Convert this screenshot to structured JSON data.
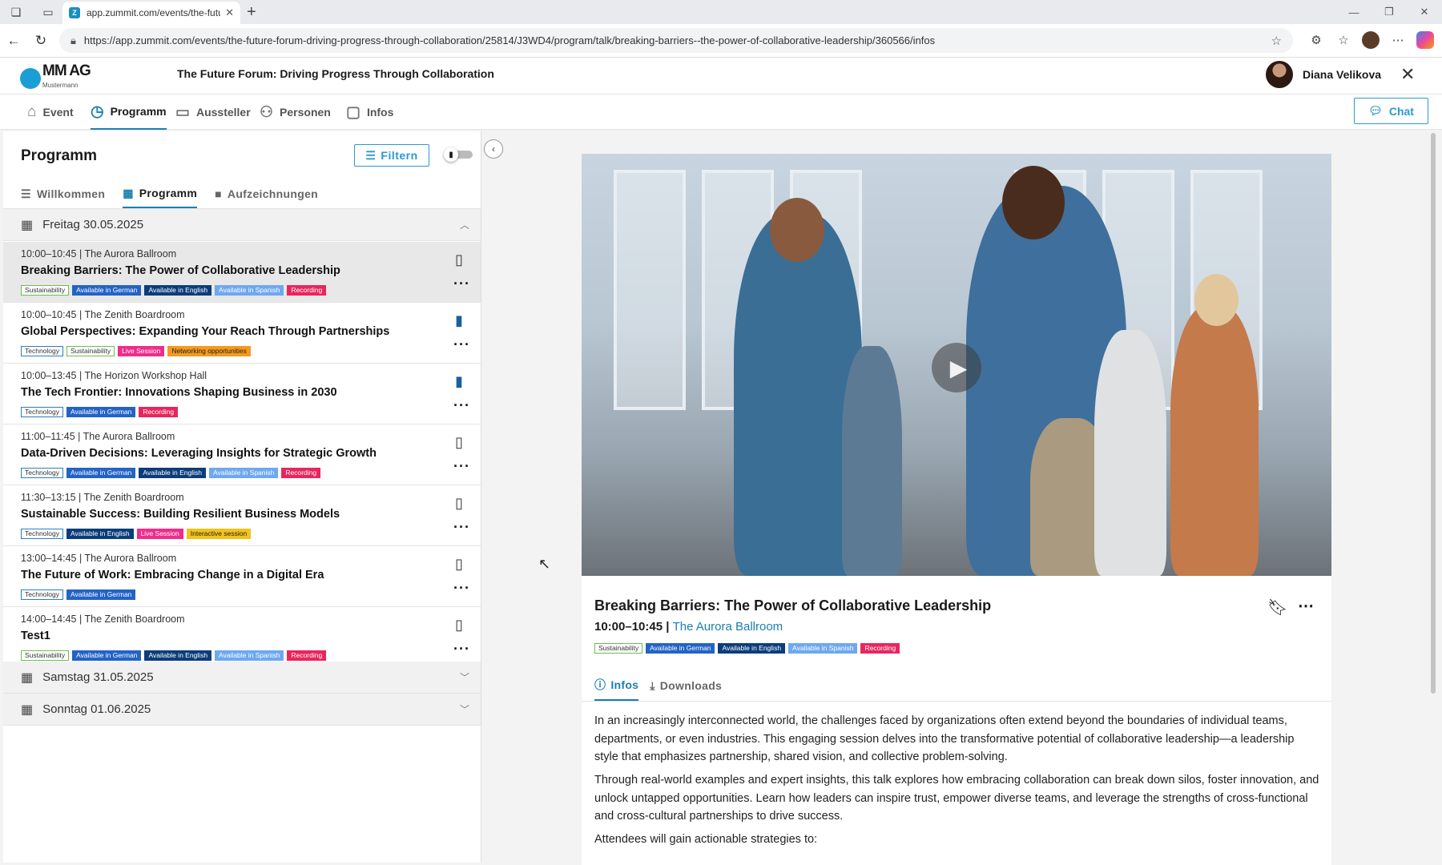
{
  "browser": {
    "tab_title": "app.zummit.com/events/the-futu",
    "favicon": "Z",
    "url": "https://app.zummit.com/events/the-future-forum-driving-progress-through-collaboration/25814/J3WD4/program/talk/breaking-barriers--the-power-of-collaborative-leadership/360566/infos"
  },
  "header": {
    "logo_brand": "MM AG",
    "logo_sub": "Mustermann",
    "event_title": "The Future Forum: Driving Progress Through Collaboration",
    "user_name": "Diana Velikova"
  },
  "nav": {
    "items": [
      {
        "label": "Event",
        "icon": "home-icon"
      },
      {
        "label": "Programm",
        "icon": "clock-icon"
      },
      {
        "label": "Aussteller",
        "icon": "presentation-icon"
      },
      {
        "label": "Personen",
        "icon": "people-icon"
      },
      {
        "label": "Infos",
        "icon": "chat-bubble-icon"
      }
    ],
    "active": "Programm",
    "chat_label": "Chat"
  },
  "program": {
    "title": "Programm",
    "filter_label": "Filtern",
    "subtabs": [
      {
        "label": "Willkommen",
        "icon": "list-icon"
      },
      {
        "label": "Programm",
        "icon": "briefcase-icon"
      },
      {
        "label": "Aufzeichnungen",
        "icon": "video-icon"
      }
    ],
    "days": [
      {
        "label": "Freitag 30.05.2025",
        "expanded": true
      },
      {
        "label": "Samstag 31.05.2025",
        "expanded": false
      },
      {
        "label": "Sonntag 01.06.2025",
        "expanded": false
      }
    ],
    "sessions": [
      {
        "meta": "10:00–10:45 | The Aurora Ballroom",
        "title": "Breaking Barriers: The Power of Collaborative Leadership",
        "bookmarked": false,
        "selected": true,
        "tags": [
          {
            "label": "Sustainability",
            "kind": "sus"
          },
          {
            "label": "Available in German",
            "kind": "de"
          },
          {
            "label": "Available in English",
            "kind": "en"
          },
          {
            "label": "Available in Spanish",
            "kind": "es"
          },
          {
            "label": "Recording",
            "kind": "rec"
          }
        ]
      },
      {
        "meta": "10:00–10:45 | The Zenith Boardroom",
        "title": "Global Perspectives: Expanding Your Reach Through Partnerships",
        "bookmarked": true,
        "selected": false,
        "tags": [
          {
            "label": "Technology",
            "kind": "tech"
          },
          {
            "label": "Sustainability",
            "kind": "sus"
          },
          {
            "label": "Live Session",
            "kind": "live"
          },
          {
            "label": "Networking opportunities",
            "kind": "net"
          }
        ]
      },
      {
        "meta": "10:00–13:45 | The Horizon Workshop Hall",
        "title": "The Tech Frontier: Innovations Shaping Business in 2030",
        "bookmarked": true,
        "selected": false,
        "tags": [
          {
            "label": "Technology",
            "kind": "tech"
          },
          {
            "label": "Available in German",
            "kind": "de"
          },
          {
            "label": "Recording",
            "kind": "rec"
          }
        ]
      },
      {
        "meta": "11:00–11:45 | The Aurora Ballroom",
        "title": "Data-Driven Decisions: Leveraging Insights for Strategic Growth",
        "bookmarked": false,
        "selected": false,
        "tags": [
          {
            "label": "Technology",
            "kind": "tech"
          },
          {
            "label": "Available in German",
            "kind": "de"
          },
          {
            "label": "Available in English",
            "kind": "en"
          },
          {
            "label": "Available in Spanish",
            "kind": "es"
          },
          {
            "label": "Recording",
            "kind": "rec"
          }
        ]
      },
      {
        "meta": "11:30–13:15 | The Zenith Boardroom",
        "title": "Sustainable Success: Building Resilient Business Models",
        "bookmarked": false,
        "selected": false,
        "tags": [
          {
            "label": "Technology",
            "kind": "tech"
          },
          {
            "label": "Available in English",
            "kind": "en"
          },
          {
            "label": "Live Session",
            "kind": "live"
          },
          {
            "label": "Interactive session",
            "kind": "int"
          }
        ]
      },
      {
        "meta": "13:00–14:45 | The Aurora Ballroom",
        "title": "The Future of Work: Embracing Change in a Digital Era",
        "bookmarked": false,
        "selected": false,
        "tags": [
          {
            "label": "Technology",
            "kind": "tech"
          },
          {
            "label": "Available in German",
            "kind": "de"
          }
        ]
      },
      {
        "meta": "14:00–14:45 | The Zenith Boardroom",
        "title": "Test1",
        "bookmarked": false,
        "selected": false,
        "tags": [
          {
            "label": "Sustainability",
            "kind": "sus"
          },
          {
            "label": "Available in German",
            "kind": "de"
          },
          {
            "label": "Available in English",
            "kind": "en"
          },
          {
            "label": "Available in Spanish",
            "kind": "es"
          },
          {
            "label": "Recording",
            "kind": "rec"
          }
        ]
      }
    ]
  },
  "detail": {
    "title": "Breaking Barriers: The Power of Collaborative Leadership",
    "time": "10:00–10:45 |",
    "room": "The Aurora Ballroom",
    "tags": [
      {
        "label": "Sustainability",
        "kind": "sus"
      },
      {
        "label": "Available in German",
        "kind": "de"
      },
      {
        "label": "Available in English",
        "kind": "en"
      },
      {
        "label": "Available in Spanish",
        "kind": "es"
      },
      {
        "label": "Recording",
        "kind": "rec"
      }
    ],
    "tabs": [
      {
        "label": "Infos",
        "icon": "info-icon"
      },
      {
        "label": "Downloads",
        "icon": "download-icon"
      }
    ],
    "active_tab": "Infos",
    "paragraphs": [
      "In an increasingly interconnected world, the challenges faced by organizations often extend beyond the boundaries of individual teams, departments, or even industries. This engaging session delves into the transformative potential of collaborative leadership—a leadership style that emphasizes partnership, shared vision, and collective problem-solving.",
      "Through real-world examples and expert insights, this talk explores how embracing collaboration can break down silos, foster innovation, and unlock untapped opportunities. Learn how leaders can inspire trust, empower diverse teams, and leverage the strengths of cross-functional and cross-cultural partnerships to drive success.",
      "Attendees will gain actionable strategies to:"
    ]
  },
  "colors": {
    "accent": "#1a7fae",
    "chat_border": "#2a9ad0",
    "bookmark_filled": "#1a5fa0"
  }
}
